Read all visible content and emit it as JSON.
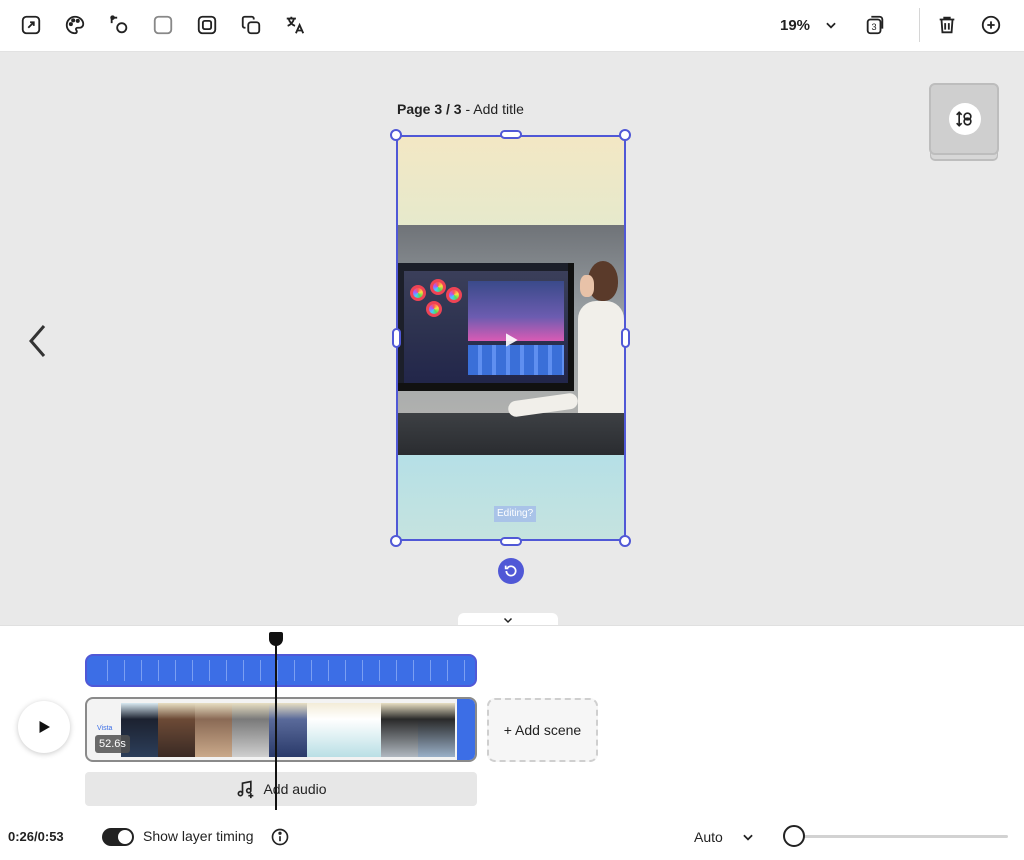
{
  "toolbar": {
    "zoom_value": "19%",
    "page_count_badge": "3",
    "icons": [
      "resize-icon",
      "palette-icon",
      "shapes-icon",
      "square-icon",
      "frame-icon",
      "duplicate-icon",
      "translate-icon",
      "chevron-down-icon",
      "pages-icon",
      "trash-icon",
      "add-icon"
    ]
  },
  "canvas": {
    "page_label_bold": "Page 3 / 3",
    "page_label_rest": " - Add title",
    "caption_text": "Editing?",
    "colors": {
      "selection": "#5058d6",
      "track_blue": "#3c6ee6"
    }
  },
  "timeline": {
    "scene_logo_text": "Vista",
    "scene_duration": "52.6s",
    "add_scene_label": "+ Add scene",
    "add_audio_label": "Add audio",
    "current_time": "0:26/0:53",
    "show_layer_timing_label": "Show layer timing",
    "show_layer_timing_on": true,
    "speed_select_value": "Auto",
    "progress_fraction": 0.49
  }
}
